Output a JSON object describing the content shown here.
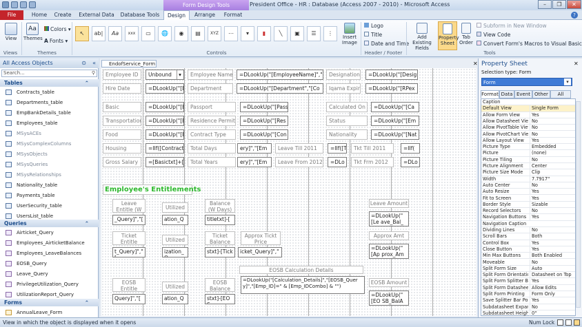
{
  "window": {
    "contextual_tab_group": "Form Design Tools",
    "title": "President Office - HR : Database (Access 2007 - 2010)  -  Microsoft Access",
    "help_label": "?"
  },
  "tabs": [
    "File",
    "Home",
    "Create",
    "External Data",
    "Database Tools",
    "Design",
    "Arrange",
    "Format"
  ],
  "ribbon": {
    "view": "View",
    "themes": "Themes",
    "colors": "Colors",
    "fonts": "Fonts",
    "groups": {
      "views": "Views",
      "themes": "Themes",
      "controls": "Controls",
      "header_footer": "Header / Footer",
      "tools": "Tools"
    },
    "insert_image": "Insert\nImage",
    "logo": "Logo",
    "title": "Title",
    "date_time": "Date and Time",
    "add_existing_fields": "Add Existing\nFields",
    "property_sheet": "Property\nSheet",
    "tab_order": "Tab\nOrder",
    "subform_new_window": "Subform in New Window",
    "view_code": "View Code",
    "convert_macros": "Convert Form's Macros to Visual Basic"
  },
  "nav": {
    "header": "All Access Objects",
    "search_placeholder": "Search...",
    "tables_label": "Tables",
    "tables": [
      {
        "name": "Contracts_table",
        "dim": false
      },
      {
        "name": "Departments_table",
        "dim": false
      },
      {
        "name": "EmpBankDetails_table",
        "dim": false
      },
      {
        "name": "Employees_table",
        "dim": false
      },
      {
        "name": "MSysACEs",
        "dim": true
      },
      {
        "name": "MSysComplexColumns",
        "dim": true
      },
      {
        "name": "MSysObjects",
        "dim": true
      },
      {
        "name": "MSysQueries",
        "dim": true
      },
      {
        "name": "MSysRelationships",
        "dim": true
      },
      {
        "name": "Nationality_table",
        "dim": false
      },
      {
        "name": "Payments_table",
        "dim": false
      },
      {
        "name": "UserSecurity_table",
        "dim": false
      },
      {
        "name": "UsersList_table",
        "dim": false
      }
    ],
    "queries_label": "Queries",
    "queries": [
      "Airticket_Query",
      "Employees_AirticketBalance",
      "Employees_LeaveBalances",
      "EOSB_Query",
      "Leave_Query",
      "PrivilegeUtilization_Query",
      "UtilizationReport_Query"
    ],
    "forms_label": "Forms",
    "forms": [
      "AnnualLeave_Form"
    ]
  },
  "document": {
    "tab": "EndofService_Form",
    "labels": {
      "employee_id": "Employee ID",
      "hire_date": "Hire Date",
      "basic": "Basic",
      "transportation": "Transportation",
      "food": "Food",
      "housing": "Housing",
      "gross_salary": "Gross Salary",
      "employee_name": "Employee Name",
      "department": "Department",
      "passport": "Passport",
      "residence_permit": "Residence Permit",
      "contract_type": "Contract Type",
      "total_days": "Total Days",
      "total_years": "Total Years",
      "designation": "Designation",
      "iqama_expiry": "Iqama Expiry",
      "calculated_on": "Calculated On",
      "status": "Status",
      "nationality": "Nationality",
      "leave_till": "Leave Till 2011",
      "leave_from": "Leave From 2012",
      "tkt_till": "Tkt Till 2011",
      "tkt_frm": "Tkt Frm 2012",
      "leave_entitle": "Leave Entitle (W Days)",
      "utilized": "Utilized",
      "balance": "Balance (W Days)",
      "ticket_entitle": "Ticket Entitle",
      "ticket_balance": "Ticket Balance",
      "approx_ticket_price": "Approx Tickt Price",
      "eosb_entitle": "EOSB Entitle",
      "eosb_balance": "EOSB Balance",
      "leave_amount": "Leave Amount",
      "approx_amt": "Approx Amt",
      "eosb_amount": "EOSB Amount",
      "eosb_calc_details": "EOSB Calculation Details"
    },
    "values": {
      "unbound": "Unbound",
      "dlookup_emp": "=DLookUp(\"[Employee",
      "dlookup_empname": "=DLookUp(\"[EmployeeName]\",\"",
      "dlookup_desig": "=DLookUp(\"[Desig",
      "dlookup_dept": "=DLookUp(\"[Department\",\"[Co",
      "dlookup_rpex": "=DLookUp(\"[RPex",
      "dlookup_pass": "=DLookUp(\"[Pass",
      "dlookup_ca": "=DLookUp(\"[Ca",
      "dlookup_res": "=DLookUp(\"[Res",
      "dlookup_em": "=DLookUp(\"[Em",
      "dlookup_con": "=DLookUp(\"[Con",
      "dlookup_nat": "=DLookUp(\"[Nat",
      "iif_contract": "=IIf([Contract",
      "ery": "ery]\",\"[Em",
      "iif_t": "=IIf([T",
      "iif": "=IIf(",
      "basictxt": "=[Basictxt]+[T",
      "dlo": "=DLo",
      "query": "_Query]\",\"[",
      "ation_qu": "ation_Qu",
      "titletxt": "titletxt]-[",
      "dlookup_le": "=DLookUp(\"[Le ave_Bal_Amt\",\"",
      "t_query": "t_Query]\",\"[",
      "ization_q": "ization_Q",
      "stxt_tick": "stxt]-[Tick",
      "ticket_query": "icket_Query]\",\"",
      "dlookup_ap": "=DLookUp(\"[Ap prox_Amt\",\"[A",
      "eosb_query": "Query]\",\"[",
      "ation_qu2": "ation_Qu",
      "stxt_eos": "stxt]-[EOS",
      "eosb_calc": "=DLookUp(\"[Calculation_Details]\",\"[EOSB_Query]\",\"[Emp_ID]=\" & [Emp_IDCombo] & \"\")",
      "dlookup_eo": "=DLookUp(\"[EO SB_BalAmt]\",\"[E"
    },
    "section_title": "Employee's Entitlements"
  },
  "property_sheet": {
    "title": "Property Sheet",
    "selection_type_label": "Selection type:",
    "selection_type": "Form",
    "selector": "Form",
    "tabs": [
      "Format",
      "Data",
      "Event",
      "Other",
      "All"
    ],
    "rows": [
      [
        "Caption",
        ""
      ],
      [
        "Default View",
        "Single Form"
      ],
      [
        "Allow Form View",
        "Yes"
      ],
      [
        "Allow Datasheet View",
        "No"
      ],
      [
        "Allow PivotTable View",
        "No"
      ],
      [
        "Allow PivotChart View",
        "No"
      ],
      [
        "Allow Layout View",
        "Yes"
      ],
      [
        "Picture Type",
        "Embedded"
      ],
      [
        "Picture",
        "(none)"
      ],
      [
        "Picture Tiling",
        "No"
      ],
      [
        "Picture Alignment",
        "Center"
      ],
      [
        "Picture Size Mode",
        "Clip"
      ],
      [
        "Width",
        "7.7917\""
      ],
      [
        "Auto Center",
        "No"
      ],
      [
        "Auto Resize",
        "Yes"
      ],
      [
        "Fit to Screen",
        "Yes"
      ],
      [
        "Border Style",
        "Sizable"
      ],
      [
        "Record Selectors",
        "No"
      ],
      [
        "Navigation Buttons",
        "Yes"
      ],
      [
        "Navigation Caption",
        ""
      ],
      [
        "Dividing Lines",
        "No"
      ],
      [
        "Scroll Bars",
        "Both"
      ],
      [
        "Control Box",
        "Yes"
      ],
      [
        "Close Button",
        "Yes"
      ],
      [
        "Min Max Buttons",
        "Both Enabled"
      ],
      [
        "Moveable",
        "No"
      ],
      [
        "Split Form Size",
        "Auto"
      ],
      [
        "Split Form Orientation",
        "Datasheet on Top"
      ],
      [
        "Split Form Splitter Bar",
        "Yes"
      ],
      [
        "Split Form Datasheet",
        "Allow Edits"
      ],
      [
        "Split Form Printing",
        "Form Only"
      ],
      [
        "Save Splitter Bar Position",
        "Yes"
      ],
      [
        "Subdatasheet Expanded",
        "No"
      ],
      [
        "Subdatasheet Height",
        "0\""
      ]
    ]
  },
  "status": {
    "text": "View in which the object is displayed when it opens",
    "num_lock": "Num Lock"
  },
  "colors": {
    "file_tab": "#c4242b",
    "contextual": "#a77fe0",
    "section_title": "#2eb82e"
  }
}
